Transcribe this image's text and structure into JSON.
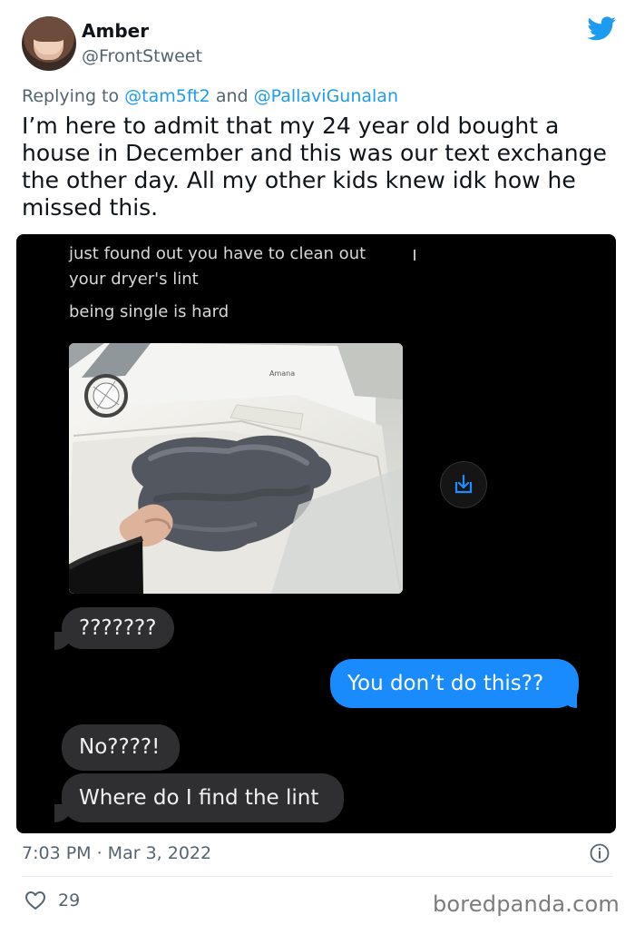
{
  "tweet": {
    "author_name": "Amber",
    "author_handle": "@FrontStweet",
    "reply_prefix": "Replying to",
    "reply_user_1": "@tam5ft2",
    "reply_connector": "and",
    "reply_user_2": "@PallaviGunalan",
    "text": "I’m here to admit that my 24 year old bought a house in December and this was our text exchange the other day. All my other kids knew idk how he missed this.",
    "timestamp": "7:03 PM · Mar 3, 2022",
    "likes": "29",
    "logo_icon": "twitter-bird-icon",
    "info_icon": "info-icon",
    "like_icon": "heart-icon"
  },
  "conversation": {
    "incoming_text_1": "just found out you have to clean out",
    "incoming_text_2": "your dryer's lint",
    "incoming_text_3": "being single is hard",
    "image_text": "Amana",
    "bubble_1": "???????",
    "bubble_2": "You don’t do this??",
    "bubble_3": "No????!",
    "bubble_4": "Where do I find the lint",
    "download_icon": "download-icon"
  },
  "footer": {
    "watermark": "boredpanda.com"
  },
  "colors": {
    "twitter_blue": "#1d9bf0",
    "message_blue": "#198bfd",
    "message_grey": "#2f2f31",
    "muted_text": "#536471"
  }
}
